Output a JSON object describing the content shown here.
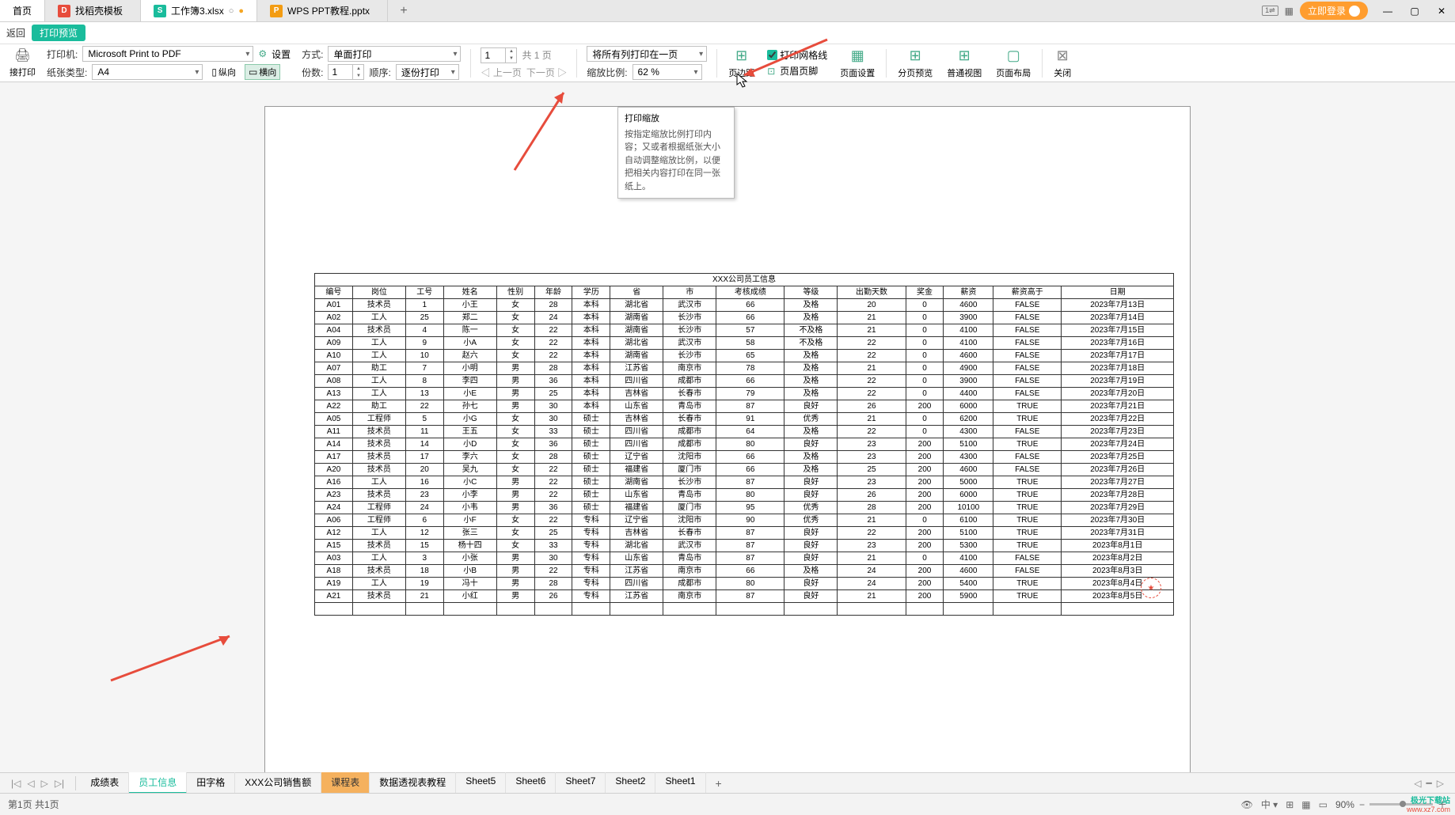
{
  "tabs": {
    "home": "首页",
    "t1": "找稻壳模板",
    "t2": "工作簿3.xlsx",
    "t3": "WPS PPT教程.pptx"
  },
  "window": {
    "login": "立即登录"
  },
  "subbar": {
    "back": "返回",
    "preview": "打印预览"
  },
  "toolbar": {
    "direct_print": "接打印",
    "printer_label": "打印机:",
    "printer_value": "Microsoft Print to PDF",
    "paper_label": "纸张类型:",
    "paper_value": "A4",
    "settings": "设置",
    "mode_label": "方式:",
    "mode_value": "单面打印",
    "copies_label": "份数:",
    "copies_value": "1",
    "order_label": "顺序:",
    "order_value": "逐份打印",
    "portrait": "纵向",
    "landscape": "横向",
    "page_input": "1",
    "page_total": "共 1 页",
    "prev": "上一页",
    "next": "下一页",
    "scale_mode": "将所有列打印在一页",
    "scale_label": "缩放比例:",
    "scale_value": "62 %",
    "margins": "页边距",
    "gridlines": "打印网格线",
    "headerfooter": "页眉页脚",
    "pagesetup": "页面设置",
    "pagebreak": "分页预览",
    "normal": "普通视图",
    "layout": "页面布局",
    "close": "关闭"
  },
  "tooltip": {
    "title": "打印缩放",
    "body": "按指定缩放比例打印内容；又或者根据纸张大小自动调整缩放比例，以便把相关内容打印在同一张纸上。"
  },
  "table": {
    "title": "XXX公司员工信息",
    "headers": [
      "编号",
      "岗位",
      "工号",
      "姓名",
      "性别",
      "年龄",
      "学历",
      "省",
      "市",
      "考核成绩",
      "等级",
      "出勤天数",
      "奖金",
      "薪资",
      "薪资高于",
      "日期"
    ],
    "rows": [
      [
        "A01",
        "技术员",
        "1",
        "小王",
        "女",
        "28",
        "本科",
        "湖北省",
        "武汉市",
        "66",
        "及格",
        "20",
        "0",
        "4600",
        "FALSE",
        "2023年7月13日"
      ],
      [
        "A02",
        "工人",
        "25",
        "郑二",
        "女",
        "24",
        "本科",
        "湖南省",
        "长沙市",
        "66",
        "及格",
        "21",
        "0",
        "3900",
        "FALSE",
        "2023年7月14日"
      ],
      [
        "A04",
        "技术员",
        "4",
        "陈一",
        "女",
        "22",
        "本科",
        "湖南省",
        "长沙市",
        "57",
        "不及格",
        "21",
        "0",
        "4100",
        "FALSE",
        "2023年7月15日"
      ],
      [
        "A09",
        "工人",
        "9",
        "小A",
        "女",
        "22",
        "本科",
        "湖北省",
        "武汉市",
        "58",
        "不及格",
        "22",
        "0",
        "4100",
        "FALSE",
        "2023年7月16日"
      ],
      [
        "A10",
        "工人",
        "10",
        "赵六",
        "女",
        "22",
        "本科",
        "湖南省",
        "长沙市",
        "65",
        "及格",
        "22",
        "0",
        "4600",
        "FALSE",
        "2023年7月17日"
      ],
      [
        "A07",
        "助工",
        "7",
        "小明",
        "男",
        "28",
        "本科",
        "江苏省",
        "南京市",
        "78",
        "及格",
        "21",
        "0",
        "4900",
        "FALSE",
        "2023年7月18日"
      ],
      [
        "A08",
        "工人",
        "8",
        "李四",
        "男",
        "36",
        "本科",
        "四川省",
        "成都市",
        "66",
        "及格",
        "22",
        "0",
        "3900",
        "FALSE",
        "2023年7月19日"
      ],
      [
        "A13",
        "工人",
        "13",
        "小E",
        "男",
        "25",
        "本科",
        "吉林省",
        "长春市",
        "79",
        "及格",
        "22",
        "0",
        "4400",
        "FALSE",
        "2023年7月20日"
      ],
      [
        "A22",
        "助工",
        "22",
        "孙七",
        "男",
        "30",
        "本科",
        "山东省",
        "青岛市",
        "87",
        "良好",
        "26",
        "200",
        "6000",
        "TRUE",
        "2023年7月21日"
      ],
      [
        "A05",
        "工程师",
        "5",
        "小G",
        "女",
        "30",
        "硕士",
        "吉林省",
        "长春市",
        "91",
        "优秀",
        "21",
        "0",
        "6200",
        "TRUE",
        "2023年7月22日"
      ],
      [
        "A11",
        "技术员",
        "11",
        "王五",
        "女",
        "33",
        "硕士",
        "四川省",
        "成都市",
        "64",
        "及格",
        "22",
        "0",
        "4300",
        "FALSE",
        "2023年7月23日"
      ],
      [
        "A14",
        "技术员",
        "14",
        "小D",
        "女",
        "36",
        "硕士",
        "四川省",
        "成都市",
        "80",
        "良好",
        "23",
        "200",
        "5100",
        "TRUE",
        "2023年7月24日"
      ],
      [
        "A17",
        "技术员",
        "17",
        "李六",
        "女",
        "28",
        "硕士",
        "辽宁省",
        "沈阳市",
        "66",
        "及格",
        "23",
        "200",
        "4300",
        "FALSE",
        "2023年7月25日"
      ],
      [
        "A20",
        "技术员",
        "20",
        "吴九",
        "女",
        "22",
        "硕士",
        "福建省",
        "厦门市",
        "66",
        "及格",
        "25",
        "200",
        "4600",
        "FALSE",
        "2023年7月26日"
      ],
      [
        "A16",
        "工人",
        "16",
        "小C",
        "男",
        "22",
        "硕士",
        "湖南省",
        "长沙市",
        "87",
        "良好",
        "23",
        "200",
        "5000",
        "TRUE",
        "2023年7月27日"
      ],
      [
        "A23",
        "技术员",
        "23",
        "小李",
        "男",
        "22",
        "硕士",
        "山东省",
        "青岛市",
        "80",
        "良好",
        "26",
        "200",
        "6000",
        "TRUE",
        "2023年7月28日"
      ],
      [
        "A24",
        "工程师",
        "24",
        "小韦",
        "男",
        "36",
        "硕士",
        "福建省",
        "厦门市",
        "95",
        "优秀",
        "28",
        "200",
        "10100",
        "TRUE",
        "2023年7月29日"
      ],
      [
        "A06",
        "工程师",
        "6",
        "小F",
        "女",
        "22",
        "专科",
        "辽宁省",
        "沈阳市",
        "90",
        "优秀",
        "21",
        "0",
        "6100",
        "TRUE",
        "2023年7月30日"
      ],
      [
        "A12",
        "工人",
        "12",
        "张三",
        "女",
        "25",
        "专科",
        "吉林省",
        "长春市",
        "87",
        "良好",
        "22",
        "200",
        "5100",
        "TRUE",
        "2023年7月31日"
      ],
      [
        "A15",
        "技术员",
        "15",
        "杨十四",
        "女",
        "33",
        "专科",
        "湖北省",
        "武汉市",
        "87",
        "良好",
        "23",
        "200",
        "5300",
        "TRUE",
        "2023年8月1日"
      ],
      [
        "A03",
        "工人",
        "3",
        "小张",
        "男",
        "30",
        "专科",
        "山东省",
        "青岛市",
        "87",
        "良好",
        "21",
        "0",
        "4100",
        "FALSE",
        "2023年8月2日"
      ],
      [
        "A18",
        "技术员",
        "18",
        "小B",
        "男",
        "22",
        "专科",
        "江苏省",
        "南京市",
        "66",
        "及格",
        "24",
        "200",
        "4600",
        "FALSE",
        "2023年8月3日"
      ],
      [
        "A19",
        "工人",
        "19",
        "冯十",
        "男",
        "28",
        "专科",
        "四川省",
        "成都市",
        "80",
        "良好",
        "24",
        "200",
        "5400",
        "TRUE",
        "2023年8月4日"
      ],
      [
        "A21",
        "技术员",
        "21",
        "小红",
        "男",
        "26",
        "专科",
        "江苏省",
        "南京市",
        "87",
        "良好",
        "21",
        "200",
        "5900",
        "TRUE",
        "2023年8月5日"
      ]
    ]
  },
  "sheets": {
    "items": [
      "成绩表",
      "员工信息",
      "田字格",
      "XXX公司销售额",
      "课程表",
      "数据透视表教程",
      "Sheet5",
      "Sheet6",
      "Sheet7",
      "Sheet2",
      "Sheet1"
    ],
    "active_index": 1,
    "orange_index": 4
  },
  "status": {
    "left": "第1页 共1页",
    "zoom": "90%"
  },
  "brand": {
    "line1": "极光下载站",
    "line2": "www.xz7.com"
  },
  "watermark": "★"
}
